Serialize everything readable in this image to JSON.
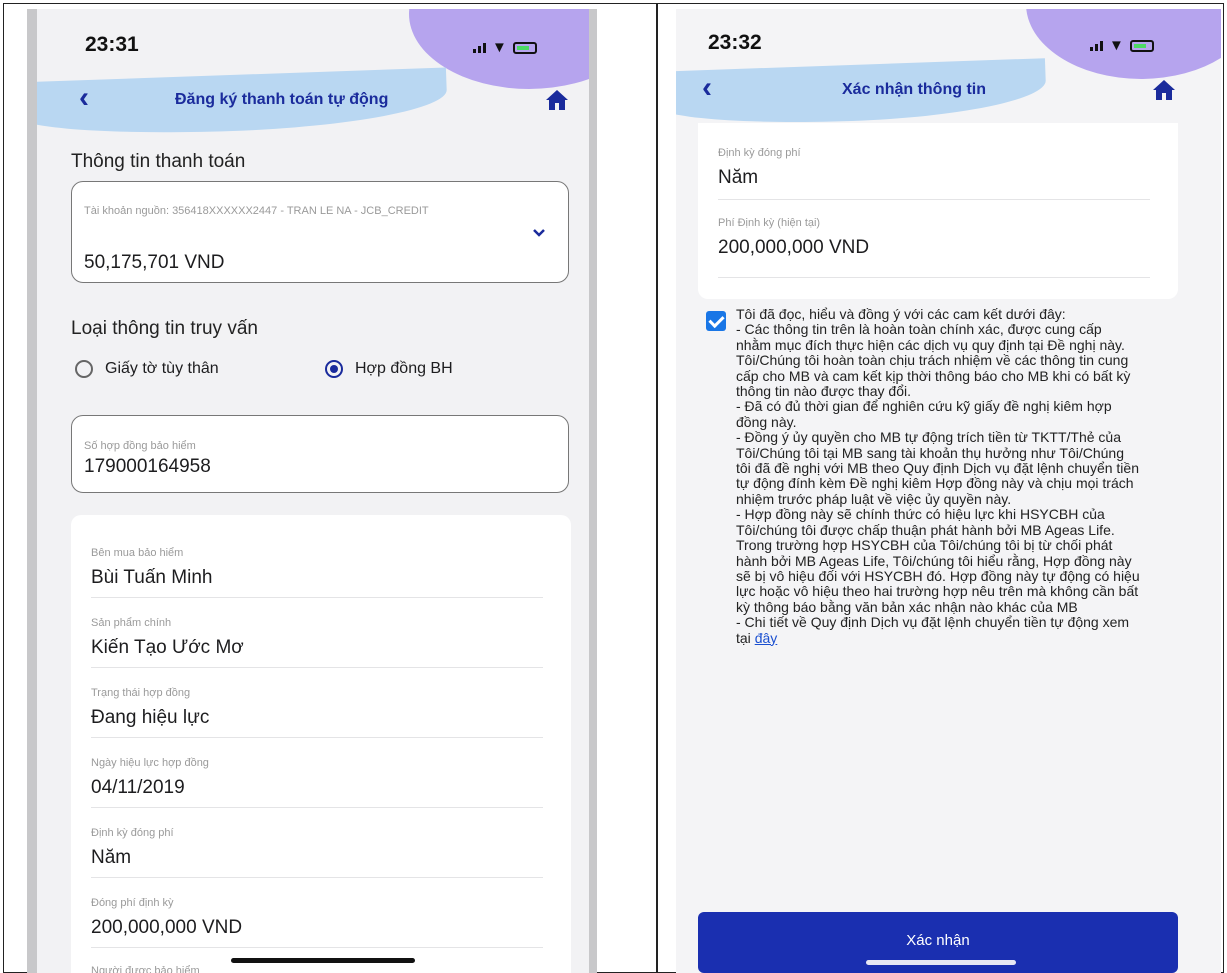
{
  "left": {
    "status": {
      "time": "23:31"
    },
    "nav": {
      "title": "Đăng ký thanh toán tự động"
    },
    "payment": {
      "section_title": "Thông tin thanh toán",
      "source_account_label": "Tài khoản nguồn: 356418XXXXXX2447 - TRAN LE NA - JCB_CREDIT",
      "balance": "50,175,701 VND"
    },
    "lookup": {
      "section_title": "Loại thông tin truy vấn",
      "option_id": "Giấy tờ tùy thân",
      "option_contract": "Hợp đồng BH",
      "selected": "Hợp đồng BH"
    },
    "contract_no": {
      "label": "Số hợp đồng bảo hiểm",
      "value": "179000164958"
    },
    "details": [
      {
        "label": "Bên mua bảo hiểm",
        "value": "Bùi Tuấn Minh"
      },
      {
        "label": "Sản phẩm chính",
        "value": "Kiến Tạo Ước Mơ"
      },
      {
        "label": "Trạng thái hợp đồng",
        "value": "Đang hiệu lực"
      },
      {
        "label": "Ngày hiệu lực hợp đồng",
        "value": "04/11/2019"
      },
      {
        "label": "Định kỳ đóng phí",
        "value": "Năm"
      },
      {
        "label": "Đóng phí định kỳ",
        "value": "200,000,000 VND"
      },
      {
        "label": "Người được bảo hiểm",
        "value": ""
      }
    ]
  },
  "right": {
    "status": {
      "time": "23:32"
    },
    "nav": {
      "title": "Xác nhận thông tin"
    },
    "details": [
      {
        "label": "Định kỳ đóng phí",
        "value": "Năm"
      },
      {
        "label": "Phí Định kỳ (hiện tại)",
        "value": "200,000,000 VND"
      }
    ],
    "agree_checked": true,
    "terms": {
      "intro": "Tôi đã đọc, hiểu và đồng ý với các cam kết dưới đây:",
      "p1": "- Các thông tin trên là hoàn toàn chính xác, được cung cấp nhằm mục đích thực hiện các dịch vụ quy định tại Đề nghị này. Tôi/Chúng tôi hoàn toàn chịu trách nhiệm về các thông tin cung cấp cho MB và cam kết kịp thời thông báo cho MB khi có bất kỳ thông tin nào được thay đổi.",
      "p2": "- Đã có đủ thời gian để nghiên cứu kỹ giấy đề nghị kiêm hợp đồng này.",
      "p3": "- Đồng ý ủy quyền cho MB tự động trích tiền từ TKTT/Thẻ của Tôi/Chúng tôi tại MB sang tài khoản thụ hưởng như Tôi/Chúng tôi đã đề nghị với MB theo Quy định Dịch vụ đặt lệnh chuyển tiền tự động đính kèm Đề nghị kiêm Hợp đồng này và chịu mọi trách nhiệm trước pháp luật về việc ủy quyền này.",
      "p4": "- Hợp đồng này sẽ chính thức có hiệu lực khi HSYCBH của Tôi/chúng tôi được chấp thuận phát hành bởi MB Ageas Life. Trong trường hợp HSYCBH của Tôi/chúng tôi bị từ chối phát hành bởi MB Ageas Life, Tôi/chúng tôi hiểu rằng, Hợp đồng này sẽ bị vô hiệu đối với HSYCBH đó. Hợp đồng này tự động có hiệu lực hoặc vô hiệu theo hai trường hợp nêu trên mà không cần bất kỳ thông báo bằng văn bản xác nhận nào khác của MB",
      "p5_text": "- Chi tiết về Quy định Dịch vụ đặt lệnh chuyển tiền tự động xem tại ",
      "p5_link": "đây"
    },
    "confirm_label": "Xác nhận"
  }
}
